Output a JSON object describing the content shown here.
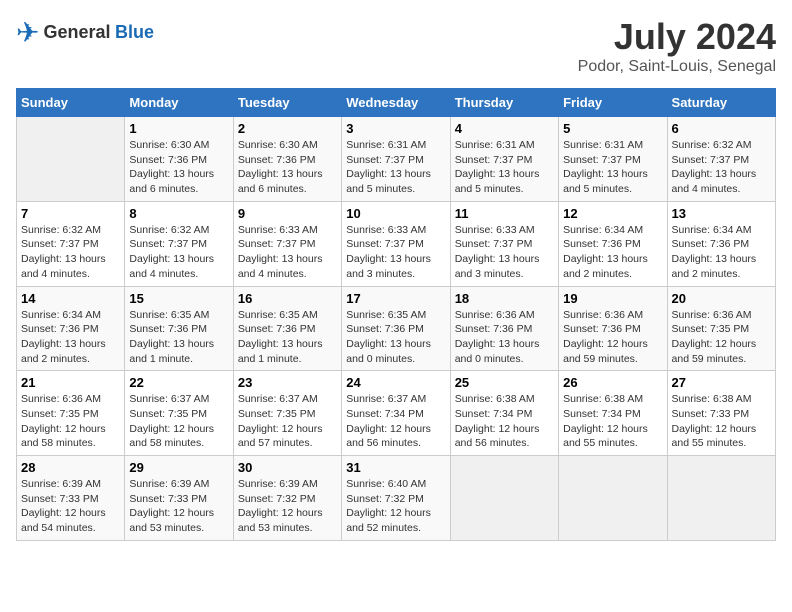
{
  "header": {
    "logo_general": "General",
    "logo_blue": "Blue",
    "title": "July 2024",
    "subtitle": "Podor, Saint-Louis, Senegal"
  },
  "weekdays": [
    "Sunday",
    "Monday",
    "Tuesday",
    "Wednesday",
    "Thursday",
    "Friday",
    "Saturday"
  ],
  "weeks": [
    [
      {
        "day": "",
        "empty": true
      },
      {
        "day": "1",
        "sunrise": "Sunrise: 6:30 AM",
        "sunset": "Sunset: 7:36 PM",
        "daylight": "Daylight: 13 hours and 6 minutes."
      },
      {
        "day": "2",
        "sunrise": "Sunrise: 6:30 AM",
        "sunset": "Sunset: 7:36 PM",
        "daylight": "Daylight: 13 hours and 6 minutes."
      },
      {
        "day": "3",
        "sunrise": "Sunrise: 6:31 AM",
        "sunset": "Sunset: 7:37 PM",
        "daylight": "Daylight: 13 hours and 5 minutes."
      },
      {
        "day": "4",
        "sunrise": "Sunrise: 6:31 AM",
        "sunset": "Sunset: 7:37 PM",
        "daylight": "Daylight: 13 hours and 5 minutes."
      },
      {
        "day": "5",
        "sunrise": "Sunrise: 6:31 AM",
        "sunset": "Sunset: 7:37 PM",
        "daylight": "Daylight: 13 hours and 5 minutes."
      },
      {
        "day": "6",
        "sunrise": "Sunrise: 6:32 AM",
        "sunset": "Sunset: 7:37 PM",
        "daylight": "Daylight: 13 hours and 4 minutes."
      }
    ],
    [
      {
        "day": "7",
        "sunrise": "Sunrise: 6:32 AM",
        "sunset": "Sunset: 7:37 PM",
        "daylight": "Daylight: 13 hours and 4 minutes."
      },
      {
        "day": "8",
        "sunrise": "Sunrise: 6:32 AM",
        "sunset": "Sunset: 7:37 PM",
        "daylight": "Daylight: 13 hours and 4 minutes."
      },
      {
        "day": "9",
        "sunrise": "Sunrise: 6:33 AM",
        "sunset": "Sunset: 7:37 PM",
        "daylight": "Daylight: 13 hours and 4 minutes."
      },
      {
        "day": "10",
        "sunrise": "Sunrise: 6:33 AM",
        "sunset": "Sunset: 7:37 PM",
        "daylight": "Daylight: 13 hours and 3 minutes."
      },
      {
        "day": "11",
        "sunrise": "Sunrise: 6:33 AM",
        "sunset": "Sunset: 7:37 PM",
        "daylight": "Daylight: 13 hours and 3 minutes."
      },
      {
        "day": "12",
        "sunrise": "Sunrise: 6:34 AM",
        "sunset": "Sunset: 7:36 PM",
        "daylight": "Daylight: 13 hours and 2 minutes."
      },
      {
        "day": "13",
        "sunrise": "Sunrise: 6:34 AM",
        "sunset": "Sunset: 7:36 PM",
        "daylight": "Daylight: 13 hours and 2 minutes."
      }
    ],
    [
      {
        "day": "14",
        "sunrise": "Sunrise: 6:34 AM",
        "sunset": "Sunset: 7:36 PM",
        "daylight": "Daylight: 13 hours and 2 minutes."
      },
      {
        "day": "15",
        "sunrise": "Sunrise: 6:35 AM",
        "sunset": "Sunset: 7:36 PM",
        "daylight": "Daylight: 13 hours and 1 minute."
      },
      {
        "day": "16",
        "sunrise": "Sunrise: 6:35 AM",
        "sunset": "Sunset: 7:36 PM",
        "daylight": "Daylight: 13 hours and 1 minute."
      },
      {
        "day": "17",
        "sunrise": "Sunrise: 6:35 AM",
        "sunset": "Sunset: 7:36 PM",
        "daylight": "Daylight: 13 hours and 0 minutes."
      },
      {
        "day": "18",
        "sunrise": "Sunrise: 6:36 AM",
        "sunset": "Sunset: 7:36 PM",
        "daylight": "Daylight: 13 hours and 0 minutes."
      },
      {
        "day": "19",
        "sunrise": "Sunrise: 6:36 AM",
        "sunset": "Sunset: 7:36 PM",
        "daylight": "Daylight: 12 hours and 59 minutes."
      },
      {
        "day": "20",
        "sunrise": "Sunrise: 6:36 AM",
        "sunset": "Sunset: 7:35 PM",
        "daylight": "Daylight: 12 hours and 59 minutes."
      }
    ],
    [
      {
        "day": "21",
        "sunrise": "Sunrise: 6:36 AM",
        "sunset": "Sunset: 7:35 PM",
        "daylight": "Daylight: 12 hours and 58 minutes."
      },
      {
        "day": "22",
        "sunrise": "Sunrise: 6:37 AM",
        "sunset": "Sunset: 7:35 PM",
        "daylight": "Daylight: 12 hours and 58 minutes."
      },
      {
        "day": "23",
        "sunrise": "Sunrise: 6:37 AM",
        "sunset": "Sunset: 7:35 PM",
        "daylight": "Daylight: 12 hours and 57 minutes."
      },
      {
        "day": "24",
        "sunrise": "Sunrise: 6:37 AM",
        "sunset": "Sunset: 7:34 PM",
        "daylight": "Daylight: 12 hours and 56 minutes."
      },
      {
        "day": "25",
        "sunrise": "Sunrise: 6:38 AM",
        "sunset": "Sunset: 7:34 PM",
        "daylight": "Daylight: 12 hours and 56 minutes."
      },
      {
        "day": "26",
        "sunrise": "Sunrise: 6:38 AM",
        "sunset": "Sunset: 7:34 PM",
        "daylight": "Daylight: 12 hours and 55 minutes."
      },
      {
        "day": "27",
        "sunrise": "Sunrise: 6:38 AM",
        "sunset": "Sunset: 7:33 PM",
        "daylight": "Daylight: 12 hours and 55 minutes."
      }
    ],
    [
      {
        "day": "28",
        "sunrise": "Sunrise: 6:39 AM",
        "sunset": "Sunset: 7:33 PM",
        "daylight": "Daylight: 12 hours and 54 minutes."
      },
      {
        "day": "29",
        "sunrise": "Sunrise: 6:39 AM",
        "sunset": "Sunset: 7:33 PM",
        "daylight": "Daylight: 12 hours and 53 minutes."
      },
      {
        "day": "30",
        "sunrise": "Sunrise: 6:39 AM",
        "sunset": "Sunset: 7:32 PM",
        "daylight": "Daylight: 12 hours and 53 minutes."
      },
      {
        "day": "31",
        "sunrise": "Sunrise: 6:40 AM",
        "sunset": "Sunset: 7:32 PM",
        "daylight": "Daylight: 12 hours and 52 minutes."
      },
      {
        "day": "",
        "empty": true
      },
      {
        "day": "",
        "empty": true
      },
      {
        "day": "",
        "empty": true
      }
    ]
  ]
}
